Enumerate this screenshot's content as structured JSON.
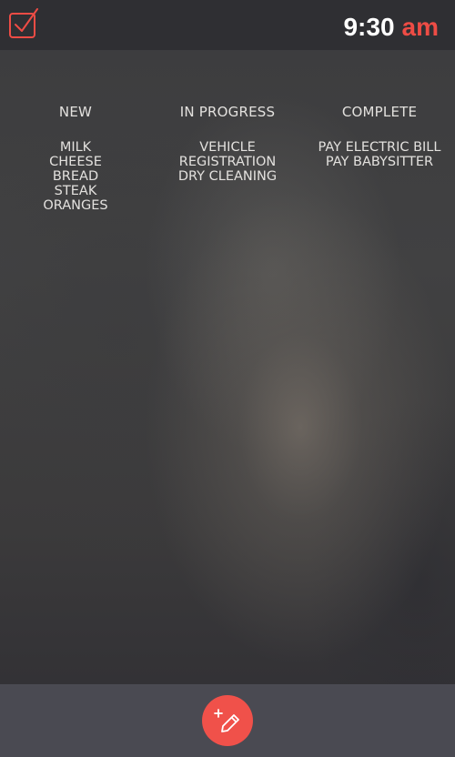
{
  "header": {
    "logo_icon": "checkbox-check-icon",
    "time": "9:30",
    "ampm": "am"
  },
  "columns": [
    {
      "title": "NEW",
      "items": [
        "MILK",
        "CHEESE",
        "BREAD",
        "STEAK",
        "ORANGES"
      ]
    },
    {
      "title": "IN PROGRESS",
      "items": [
        "VEHICLE",
        "REGISTRATION",
        "DRY CLEANING"
      ]
    },
    {
      "title": "COMPLETE",
      "items": [
        "PAY ELECTRIC BILL",
        "PAY BABYSITTER"
      ]
    }
  ],
  "footer": {
    "add_button_icon": "add-edit-icon"
  },
  "colors": {
    "accent": "#ee4c45",
    "header_bg": "#2f2f33",
    "footer_bg": "#4a4a52",
    "text": "#e3e1de"
  }
}
